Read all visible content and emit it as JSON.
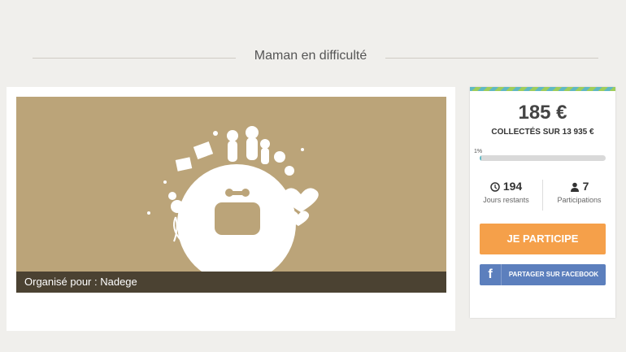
{
  "page": {
    "title": "Maman en difficulté"
  },
  "banner": {
    "organizer_text": "Organisé pour : Nadege"
  },
  "sidebar": {
    "amount": "185 €",
    "collected_text": "COLLECTÉS SUR 13 935 €",
    "progress_label": "1%",
    "progress_fraction": 0.01,
    "days_value": "194",
    "days_label": "Jours restants",
    "participants_value": "7",
    "participants_label": "Participations",
    "participate_label": "JE PARTICIPE",
    "share_icon": "f",
    "share_label": "PARTAGER SUR FACEBOOK"
  },
  "colors": {
    "banner": "#bba479",
    "organizer_bar": "#4b4232",
    "participate": "#f5a04a",
    "facebook": "#5c7fbd",
    "progress": "#5fb8c4"
  }
}
